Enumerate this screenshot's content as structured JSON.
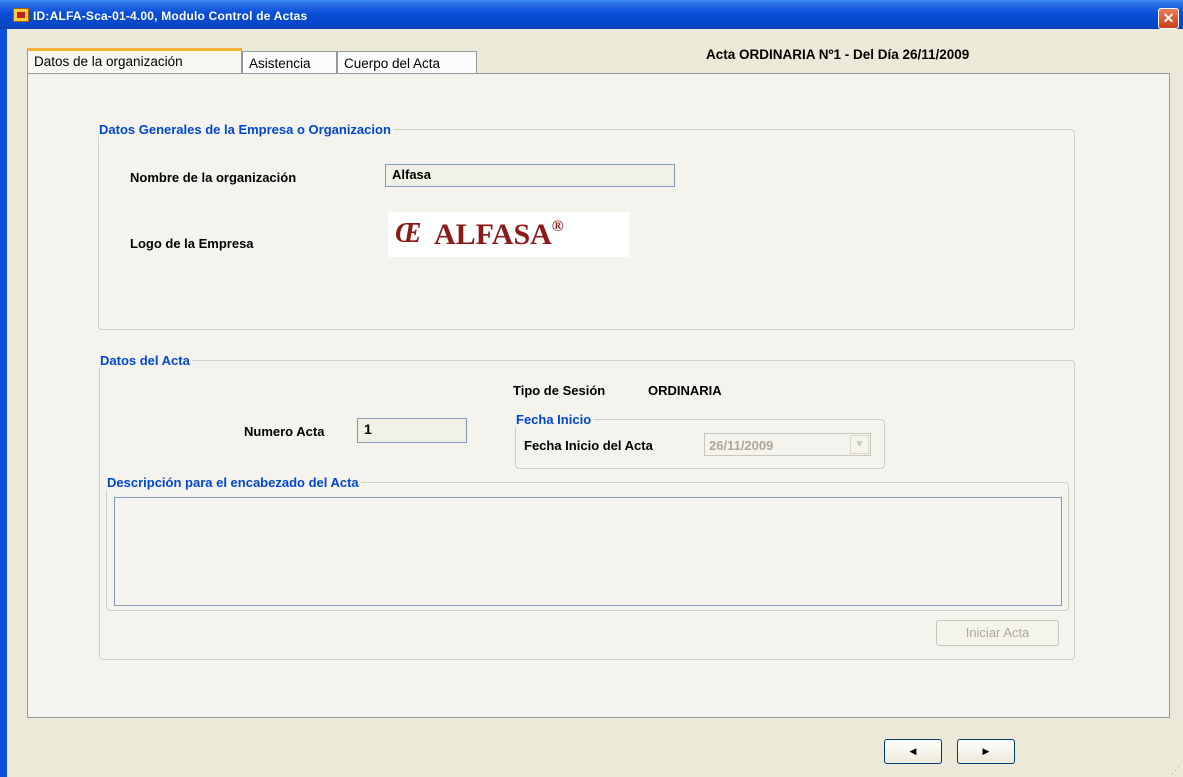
{
  "window": {
    "title": "ID:ALFA-Sca-01-4.00, Modulo Control de Actas",
    "close_glyph": "✕"
  },
  "tabs": [
    {
      "label": "Datos de la organización",
      "active": true
    },
    {
      "label": "Asistencia",
      "active": false
    },
    {
      "label": "Cuerpo del Acta",
      "active": false
    }
  ],
  "acta_header": "Acta ORDINARIA Nº1  - Del Día 26/11/2009",
  "org_group": {
    "legend": "Datos Generales de la Empresa o Organizacion",
    "name_label": "Nombre de la organización",
    "name_value": "Alfasa",
    "logo_label": "Logo de la Empresa",
    "logo_text": "ALFASA",
    "logo_mark": "Œ",
    "logo_reg": "®"
  },
  "acta_group": {
    "legend": "Datos del Acta",
    "session_label": "Tipo de Sesión",
    "session_value": "ORDINARIA",
    "numero_label": "Numero Acta",
    "numero_value": "1",
    "fecha_legend": "Fecha Inicio",
    "fecha_label": "Fecha Inicio del Acta",
    "fecha_value": "26/11/2009",
    "desc_legend": "Descripción para el encabezado del Acta",
    "desc_value": ""
  },
  "buttons": {
    "iniciar": "Iniciar Acta",
    "prev_glyph": "◀",
    "next_glyph": "▶"
  },
  "colors": {
    "titlebar": "#0a4fd8",
    "legend": "#0046d5",
    "active_tab_accent": "#f3b23a",
    "logo": "#8b1a1a"
  }
}
